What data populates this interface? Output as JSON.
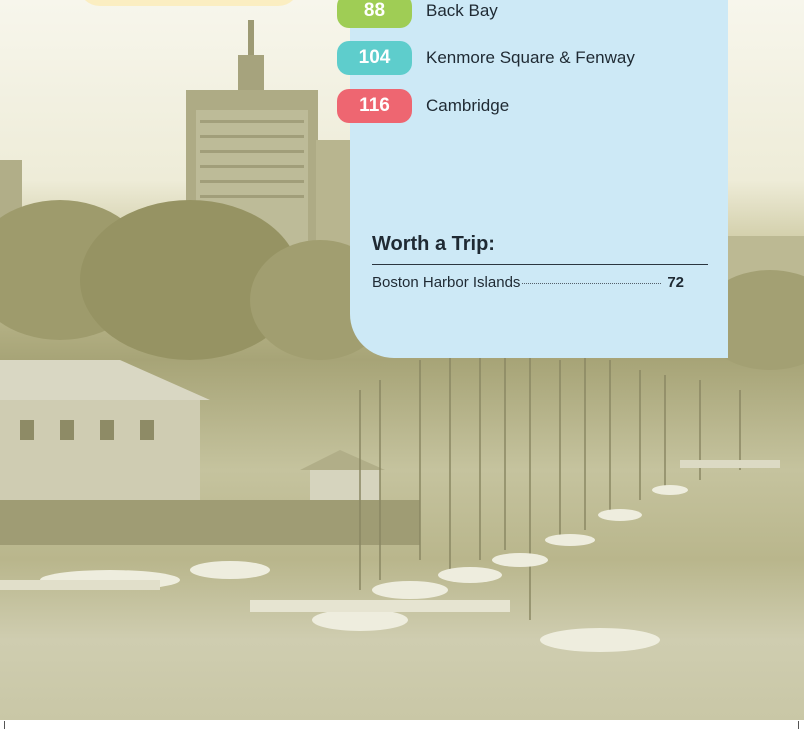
{
  "toc": {
    "entries": [
      {
        "page": "88",
        "label": "Back Bay"
      },
      {
        "page": "104",
        "label": "Kenmore Square & Fenway"
      },
      {
        "page": "116",
        "label": "Cambridge"
      }
    ],
    "worth_a_trip": {
      "title": "Worth a Trip:",
      "entry_label": "Boston Harbor Islands",
      "entry_page": "72"
    }
  },
  "colors": {
    "panel": "#cde9f6",
    "badge_green": "#9fcd55",
    "badge_teal": "#5ecdcc",
    "badge_red": "#ee6671",
    "yellow_card": "#fbeec1"
  },
  "photo": {
    "subject": "harbor-skyline-photo"
  }
}
